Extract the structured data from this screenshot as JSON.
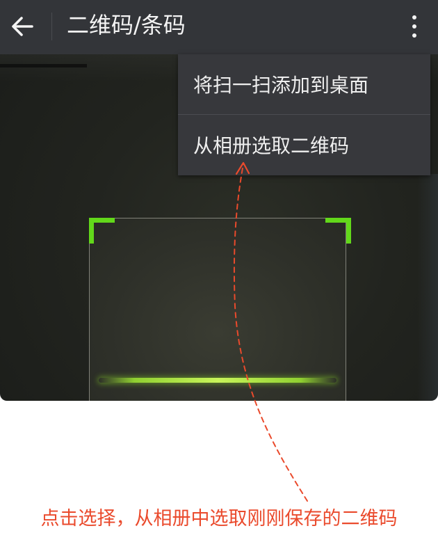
{
  "appbar": {
    "title": "二维码/条码",
    "back_icon": "arrow-left-icon",
    "more_icon": "more-vertical-icon"
  },
  "menu": {
    "items": [
      {
        "label": "将扫一扫添加到桌面"
      },
      {
        "label": "从相册选取二维码"
      }
    ]
  },
  "annotation": {
    "caption": "点击选择，从相册中选取刚刚保存的二维码",
    "color": "#ea4a2c"
  },
  "colors": {
    "appbar_bg": "#333539",
    "menu_bg": "#37383c",
    "scan_accent": "#62d81a"
  }
}
